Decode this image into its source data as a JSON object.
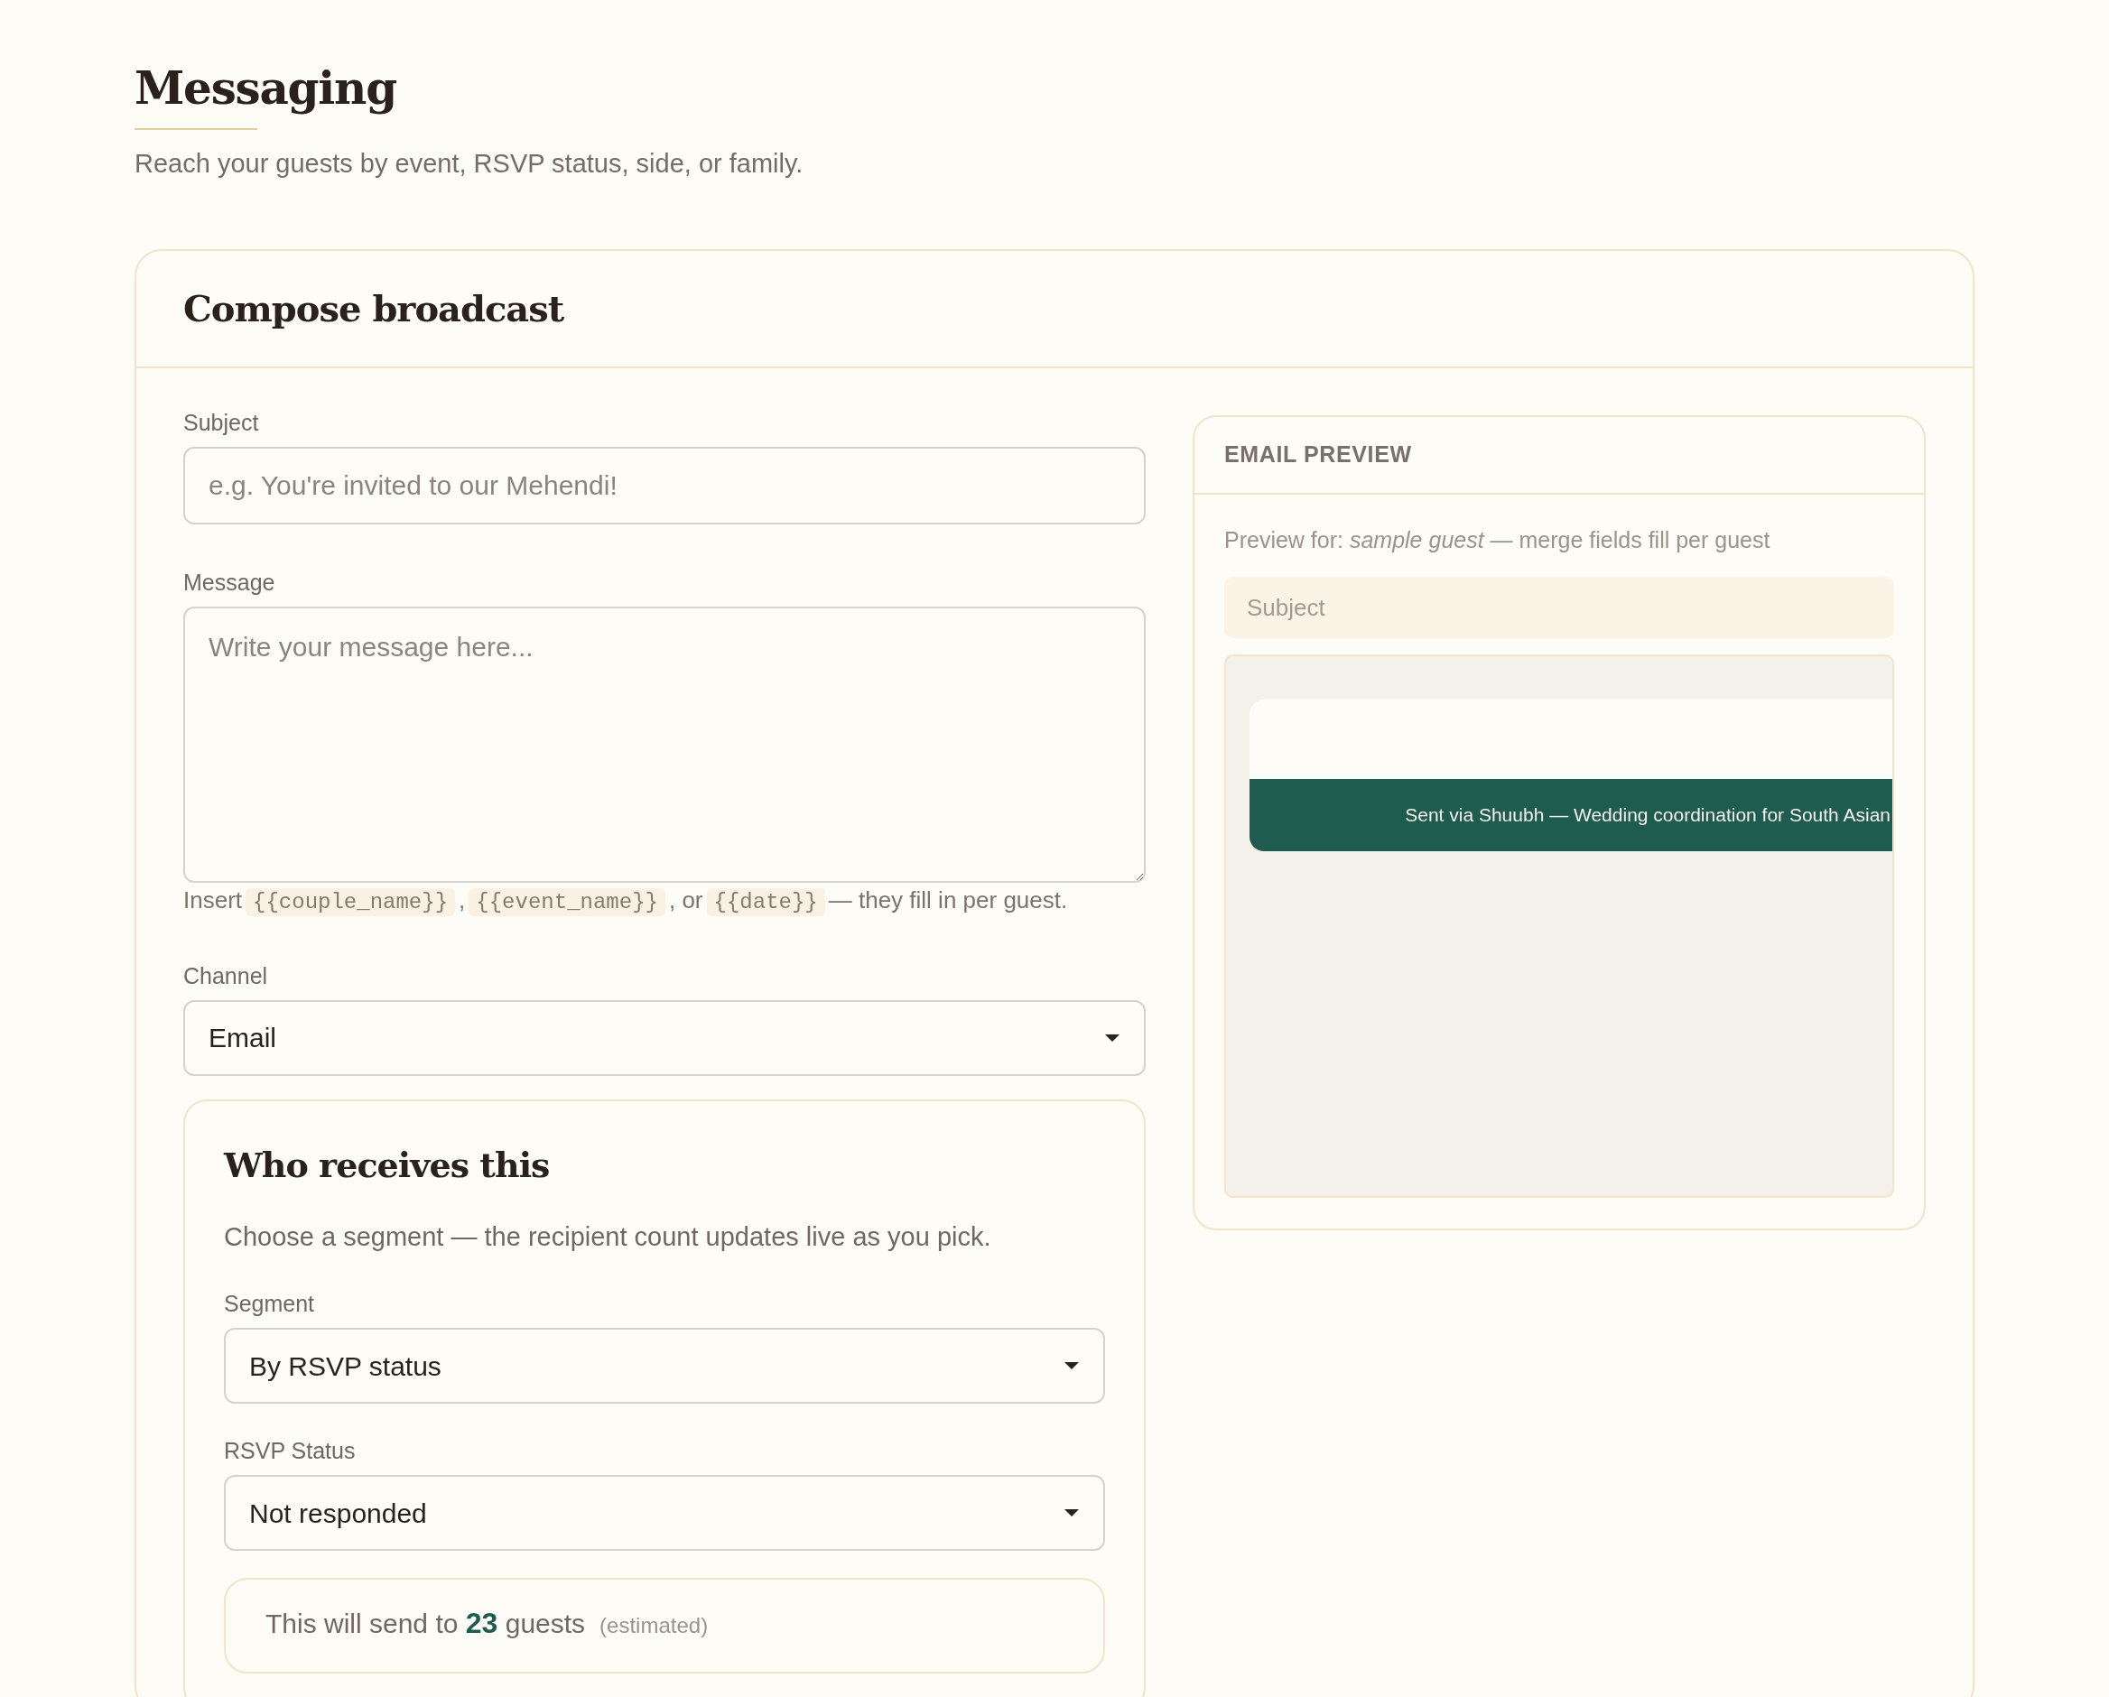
{
  "page": {
    "title": "Messaging",
    "subtitle": "Reach your guests by event, RSVP status, side, or family."
  },
  "compose": {
    "title": "Compose broadcast",
    "fields": [
      {
        "kind": "input",
        "label": "Subject",
        "placeholder": "e.g. You're invited to our Mehendi!"
      },
      {
        "kind": "textarea",
        "label": "Message",
        "placeholder": "Write your message here..."
      }
    ],
    "hint": [
      {
        "kind": "text",
        "text": "Insert"
      },
      {
        "kind": "code",
        "text": "{{couple_name}}"
      },
      {
        "kind": "text",
        "text": ","
      },
      {
        "kind": "code",
        "text": "{{event_name}}"
      },
      {
        "kind": "text",
        "text": ", or"
      },
      {
        "kind": "code",
        "text": "{{date}}"
      },
      {
        "kind": "text",
        "text": "— they fill in per guest."
      }
    ],
    "channel": {
      "label": "Channel",
      "value": "Email"
    },
    "recipients": {
      "title": "Who receives this",
      "description": "Choose a segment — the recipient count updates live as you pick.",
      "selects": [
        {
          "label": "Segment",
          "value": "By RSVP status"
        },
        {
          "label": "RSVP Status",
          "value": "Not responded"
        }
      ],
      "summary": {
        "prefix": "This will send to",
        "count": "23",
        "suffix": "guests",
        "note": "(estimated)"
      }
    }
  },
  "preview": {
    "title": "EMAIL PREVIEW",
    "caption": "Preview for: *sample guest* — merge fields fill per guest",
    "subject": "Subject",
    "footer": "Sent via Shuubh — Wedding coordination for South Asian"
  }
}
